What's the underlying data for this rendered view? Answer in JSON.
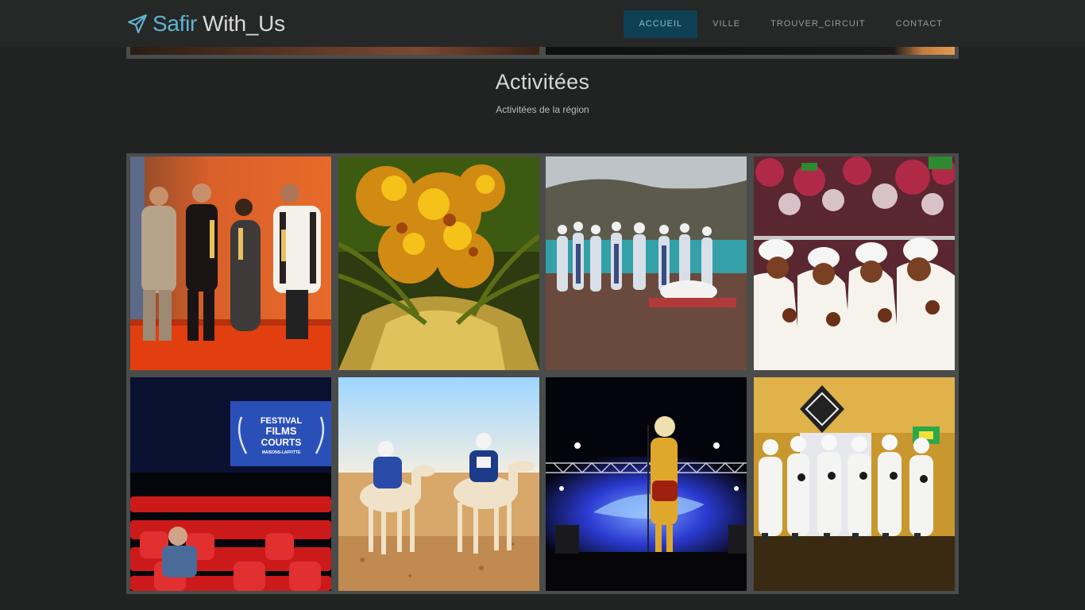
{
  "brand": {
    "part1": "Safir",
    "part2": "With_Us",
    "icon": "paper-plane-icon",
    "accent_color": "#5fb3d0"
  },
  "nav": {
    "items": [
      {
        "label": "ACCUEIL",
        "active": true
      },
      {
        "label": "VILLE",
        "active": false
      },
      {
        "label": "TROUVER_CIRCUIT",
        "active": false
      },
      {
        "label": "CONTACT",
        "active": false
      }
    ],
    "active_bg": "#0f3f52"
  },
  "section": {
    "title": "Activitées",
    "subtitle": "Activitées de la région"
  },
  "gallery": {
    "tiles": [
      {
        "name": "award-ceremony-photo"
      },
      {
        "name": "date-palm-photo"
      },
      {
        "name": "lakeside-folk-dance-photo"
      },
      {
        "name": "clapping-men-photo"
      },
      {
        "name": "film-festival-photo",
        "screen_text": [
          "FESTIVAL",
          "FILMS",
          "COURTS",
          "MAISONS-LAFFITTE"
        ]
      },
      {
        "name": "camel-race-photo"
      },
      {
        "name": "concert-stage-photo"
      },
      {
        "name": "traditional-dancers-photo"
      }
    ]
  }
}
